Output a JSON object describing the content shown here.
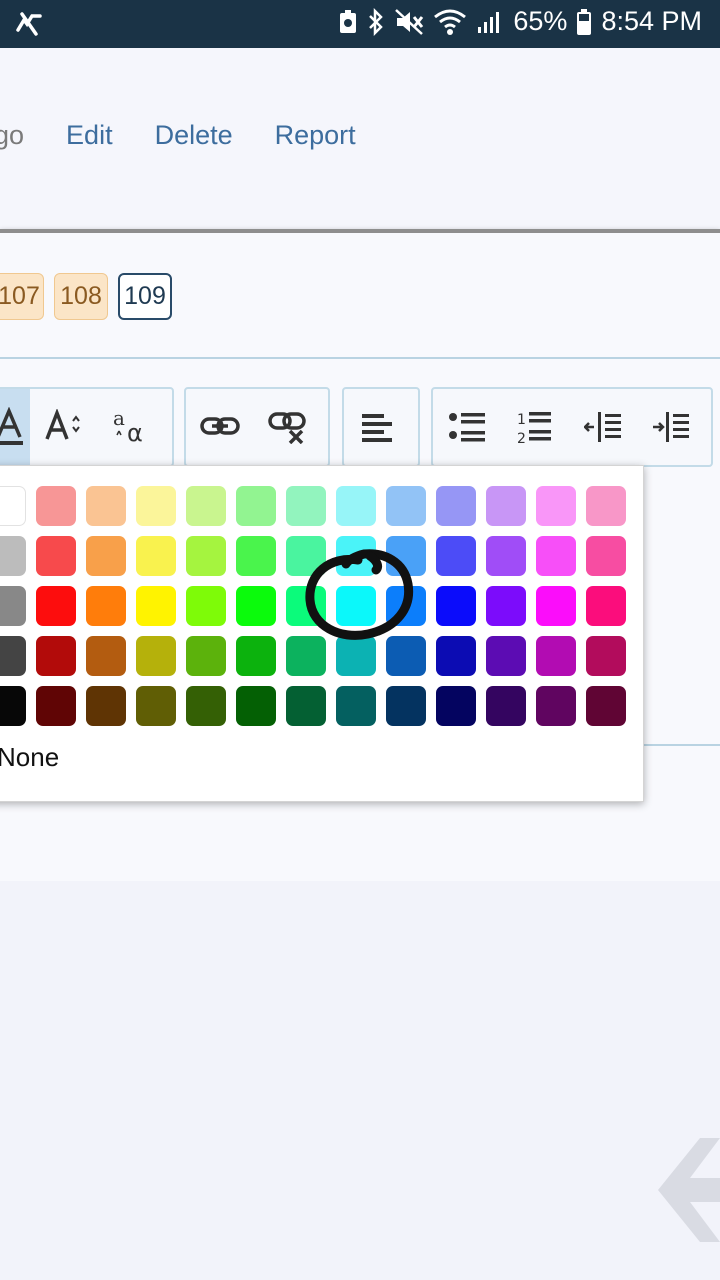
{
  "status_bar": {
    "battery": "65%",
    "time": "8:54 PM",
    "icons": [
      "notification-icon",
      "battery-saver-icon",
      "bluetooth-icon",
      "mute-icon",
      "wifi-icon",
      "signal-icon",
      "battery-icon"
    ]
  },
  "actions": {
    "ago": "go",
    "edit": "Edit",
    "delete": "Delete",
    "report": "Report"
  },
  "pagination": {
    "pages": [
      "107",
      "108",
      "109"
    ],
    "current": "109"
  },
  "toolbar": {
    "groups": [
      [
        "text-color-icon",
        "font-size-icon",
        "font-family-icon"
      ],
      [
        "link-icon",
        "unlink-icon"
      ],
      [
        "align-left-icon"
      ],
      [
        "bullet-list-icon",
        "numbered-list-icon",
        "outdent-icon",
        "indent-icon"
      ]
    ]
  },
  "color_palette": {
    "rows": [
      [
        "#ffffff",
        "#f79696",
        "#fac493",
        "#fbf59a",
        "#c9f58f",
        "#92f491",
        "#92f4be",
        "#97f5f8",
        "#92c3f6",
        "#9696f5",
        "#c896f6",
        "#f996f8",
        "#f897c8"
      ],
      [
        "#bcbcbc",
        "#f74a4c",
        "#f8a04a",
        "#f9f24e",
        "#a5f43f",
        "#4af44c",
        "#4af49f",
        "#4af3f8",
        "#4aa1f7",
        "#4c4cf7",
        "#a04df7",
        "#f74ff8",
        "#f74da2"
      ],
      [
        "#888888",
        "#fd0d0d",
        "#ff7d0b",
        "#fff300",
        "#7efb08",
        "#0bfb0c",
        "#0bfb7b",
        "#0bf8fa",
        "#0c7efb",
        "#0b0cfb",
        "#7c0cfb",
        "#fb0dfa",
        "#fb0d7c"
      ],
      [
        "#444444",
        "#b20b0a",
        "#b35c10",
        "#b5b10b",
        "#5cb20c",
        "#0cb20d",
        "#0cb25e",
        "#0cb2b3",
        "#0c5cb3",
        "#0c0cb3",
        "#5c0cb3",
        "#b20cb2",
        "#b20c5c"
      ],
      [
        "#070707",
        "#600505",
        "#5f3404",
        "#605e05",
        "#346005",
        "#046004",
        "#046033",
        "#046060",
        "#043360",
        "#040460",
        "#340560",
        "#600560",
        "#600534"
      ]
    ],
    "none_label": "None"
  },
  "accent_colors": {
    "status_bar_bg": "#1a3346",
    "link": "#3d6d9e",
    "page_badge": "#fbe5c7",
    "current_page_border": "#294b69"
  }
}
